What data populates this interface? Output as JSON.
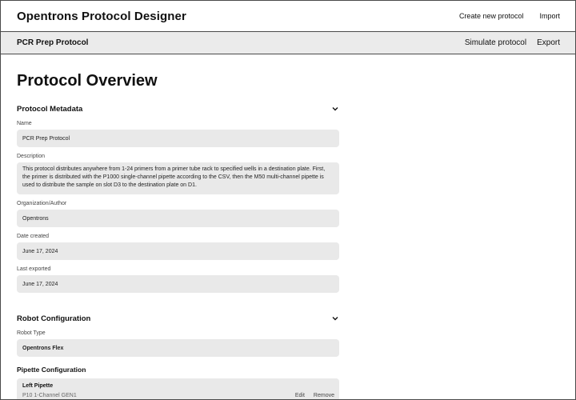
{
  "header": {
    "app_title": "Opentrons Protocol Designer",
    "nav": {
      "create": "Create new protocol",
      "import": "Import"
    }
  },
  "subheader": {
    "protocol_name": "PCR Prep Protocol",
    "simulate": "Simulate protocol",
    "export": "Export"
  },
  "page_title": "Protocol Overview",
  "metadata": {
    "title": "Protocol Metadata",
    "name_label": "Name",
    "name_value": "PCR Prep Protocol",
    "description_label": "Description",
    "description_value": "This protocol distributes anywhere from 1-24 primers from a primer tube rack to specified wells in a destination plate. First, the primer is distributed with the P1000 single-channel pipette according to the CSV, then the M50 multi-channel pipette is used to distribute the sample on slot D3 to the destination plate on D1.",
    "author_label": "Organization/Author",
    "author_value": "Opentrons",
    "created_label": "Date created",
    "created_value": "June 17, 2024",
    "exported_label": "Last exported",
    "exported_value": "June 17, 2024"
  },
  "robot": {
    "title": "Robot Configuration",
    "type_label": "Robot Type",
    "type_value": "Opentrons Flex",
    "pipette_title": "Pipette Configuration",
    "left_pipette_label": "Left Pipette",
    "left_pipette_value": "P10 1-Channel GEN1",
    "edit": "Edit",
    "remove": "Remove"
  },
  "icons": {
    "chevron": "chevron-down-icon"
  }
}
